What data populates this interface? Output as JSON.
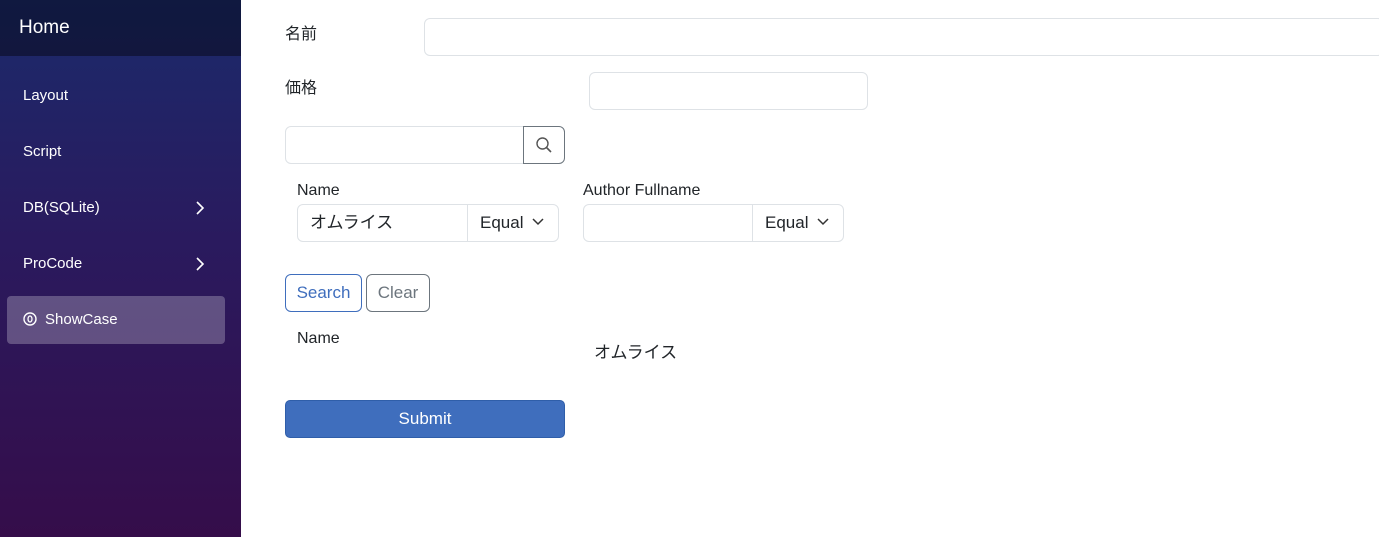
{
  "sidebar": {
    "brand": "Home",
    "items": [
      {
        "label": "Layout"
      },
      {
        "label": "Script"
      },
      {
        "label": "DB(SQLite)"
      },
      {
        "label": "ProCode"
      },
      {
        "label": "ShowCase"
      }
    ]
  },
  "form": {
    "name_label": "名前",
    "name_value": "",
    "price_label": "価格",
    "price_value": "",
    "search_value": ""
  },
  "filters": {
    "name": {
      "label": "Name",
      "value": "オムライス",
      "operator": "Equal"
    },
    "author": {
      "label": "Author Fullname",
      "value": "",
      "operator": "Equal"
    }
  },
  "buttons": {
    "search": "Search",
    "clear": "Clear",
    "submit": "Submit"
  },
  "result": {
    "label": "Name",
    "value": "オムライス"
  },
  "colors": {
    "primary": "#3f6ebd",
    "sidebar_top": "#1b2a6b",
    "sidebar_bottom": "#350d4a"
  }
}
